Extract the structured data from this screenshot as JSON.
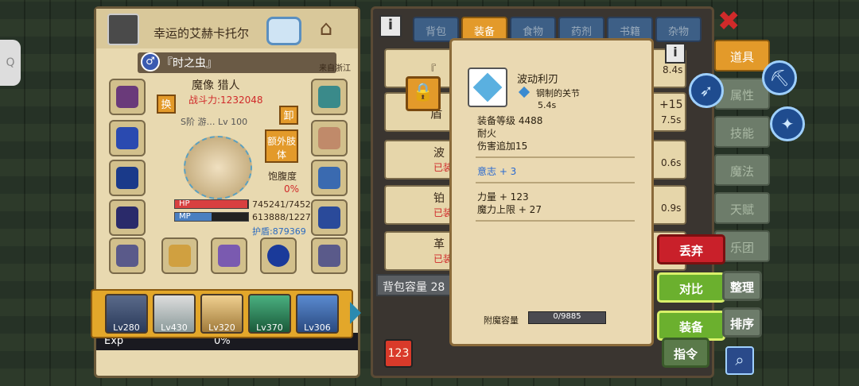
{
  "header": {
    "player_name": "幸运的艾赫卡托尔",
    "title": "『时之虫』",
    "origin": "来自浙江"
  },
  "character": {
    "class": "魔像 猎人",
    "power": "战斗力:1232048",
    "swap_label": "换",
    "unload_label": "卸",
    "extra_limb": "额外肢体",
    "rank_text": "S阶 游… Lv 100",
    "satiety_label": "饱腹度",
    "satiety_value": "0%",
    "hp_label": "HP",
    "hp_value": "745241/7452",
    "mp_label": "MP",
    "mp_value": "613888/1227",
    "shield": "护盾:879369",
    "hp_fraction": 0.99,
    "mp_fraction": 0.5
  },
  "heroes": [
    {
      "level": "Lv280"
    },
    {
      "level": "Lv430"
    },
    {
      "level": "Lv320"
    },
    {
      "level": "Lv370"
    },
    {
      "level": "Lv306"
    }
  ],
  "exp": {
    "label": "Exp",
    "value": "0%"
  },
  "bag": {
    "tabs": [
      "背包",
      "装备",
      "食物",
      "药剂",
      "书籍",
      "杂物"
    ],
    "active_tab": "装备",
    "capacity_label": "背包容量 28",
    "rows": [
      {
        "label": "『",
        "time": "8.4s"
      },
      {
        "label": "盾",
        "bonus": "+15",
        "time": "7.5s"
      },
      {
        "label": "波",
        "equipped": "已装",
        "time": "0.6s"
      },
      {
        "label": "铂",
        "equipped": "已装",
        "time": "0.9s"
      },
      {
        "label": "革",
        "equipped": "已装",
        "time": ""
      }
    ]
  },
  "popup": {
    "item_name": "波动利刃",
    "material": "钢制的关节",
    "speed": "5.4s",
    "level_line": "装备等级 4488",
    "attr1": "耐火",
    "attr2": "伤害追加15",
    "will": "意志 + 3",
    "str": "力量 + 123",
    "mana": "魔力上限 + 27",
    "enchant_label": "附魔容量",
    "enchant_value": "0/9885"
  },
  "right": {
    "tabs": [
      "道具",
      "属性",
      "技能",
      "魔法",
      "天赋",
      "乐团"
    ],
    "active_tab": "道具",
    "discard": "丢弃",
    "compare": "对比",
    "equip": "装备",
    "arrange": "整理",
    "sort": "排序",
    "command": "指令"
  },
  "colors": {
    "accent_orange": "#e39a2a",
    "discard_red": "#c9202a",
    "green_btn": "#6bb02e",
    "hp": "#d84040",
    "mp": "#4a7fc0"
  }
}
